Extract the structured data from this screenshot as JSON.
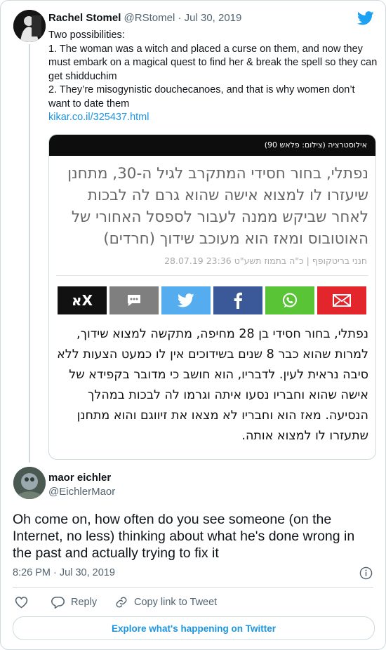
{
  "tweet1": {
    "name": "Rachel Stomel",
    "handle": "@RStomel",
    "date": "Jul 30, 2019",
    "lines": [
      "Two possibilities:",
      "1. The woman was a witch and placed a curse on them, and now they must embark on a magical quest to find her & break the spell so they can get shidduchim",
      "2. They’re misogynistic douchecanoes, and that is why women don’t want to date them"
    ],
    "link": "kikar.co.il/325437.html"
  },
  "article": {
    "caption": "אילוסטרציה (צילום: פלאש 90)",
    "title": "נפתלי, בחור חסידי המתקרב לגיל ה-30, מתחנן שיעזרו לו למצוא אישה שהוא גרם לה לבכות לאחר שביקש ממנה לעבור לספסל האחורי של האוטובוס ומאז הוא מעוכב שידוך (חרדים)",
    "meta": "חנני בריטקופף | כ\"ה בתמוז תשע\"ט 23:36 28.07.19",
    "body": "נפתלי, בחור חסידי בן 28 מחיפה, מתקשה למצוא שידוך, למרות שהוא כבר 8 שנים בשידוכים אין לו כמעט הצעות ללא סיבה נראית לעין. לדבריו, הוא חושב כי מדובר בקפידא של אישה שהוא וחבריו נסעו איתה וגרמו לה לבכות במהלך הנסיעה. מאז הוא וחבריו לא מצאו את זיווגם והוא מתחנן שתעזרו לו למצוא אותה.",
    "share_labels": {
      "kikar": "אX"
    },
    "share_colors": {
      "kikar": "#111111",
      "comment": "#7f7f7f",
      "twitter": "#55acee",
      "facebook": "#3b5998",
      "whatsapp": "#58c436",
      "email": "#e2262b"
    }
  },
  "tweet2": {
    "name": "maor eichler",
    "handle": "@EichlerMaor",
    "text": "Oh come on, how often do you see someone (on the Internet, no less) thinking about what he's done wrong in the past and actually trying to fix it",
    "time": "8:26 PM · Jul 30, 2019"
  },
  "actions": {
    "reply": "Reply",
    "copy": "Copy link to Tweet"
  },
  "explore": "Explore what's happening on Twitter",
  "colors": {
    "twitter_blue": "#1da1f2",
    "link": "#1b95e0"
  }
}
